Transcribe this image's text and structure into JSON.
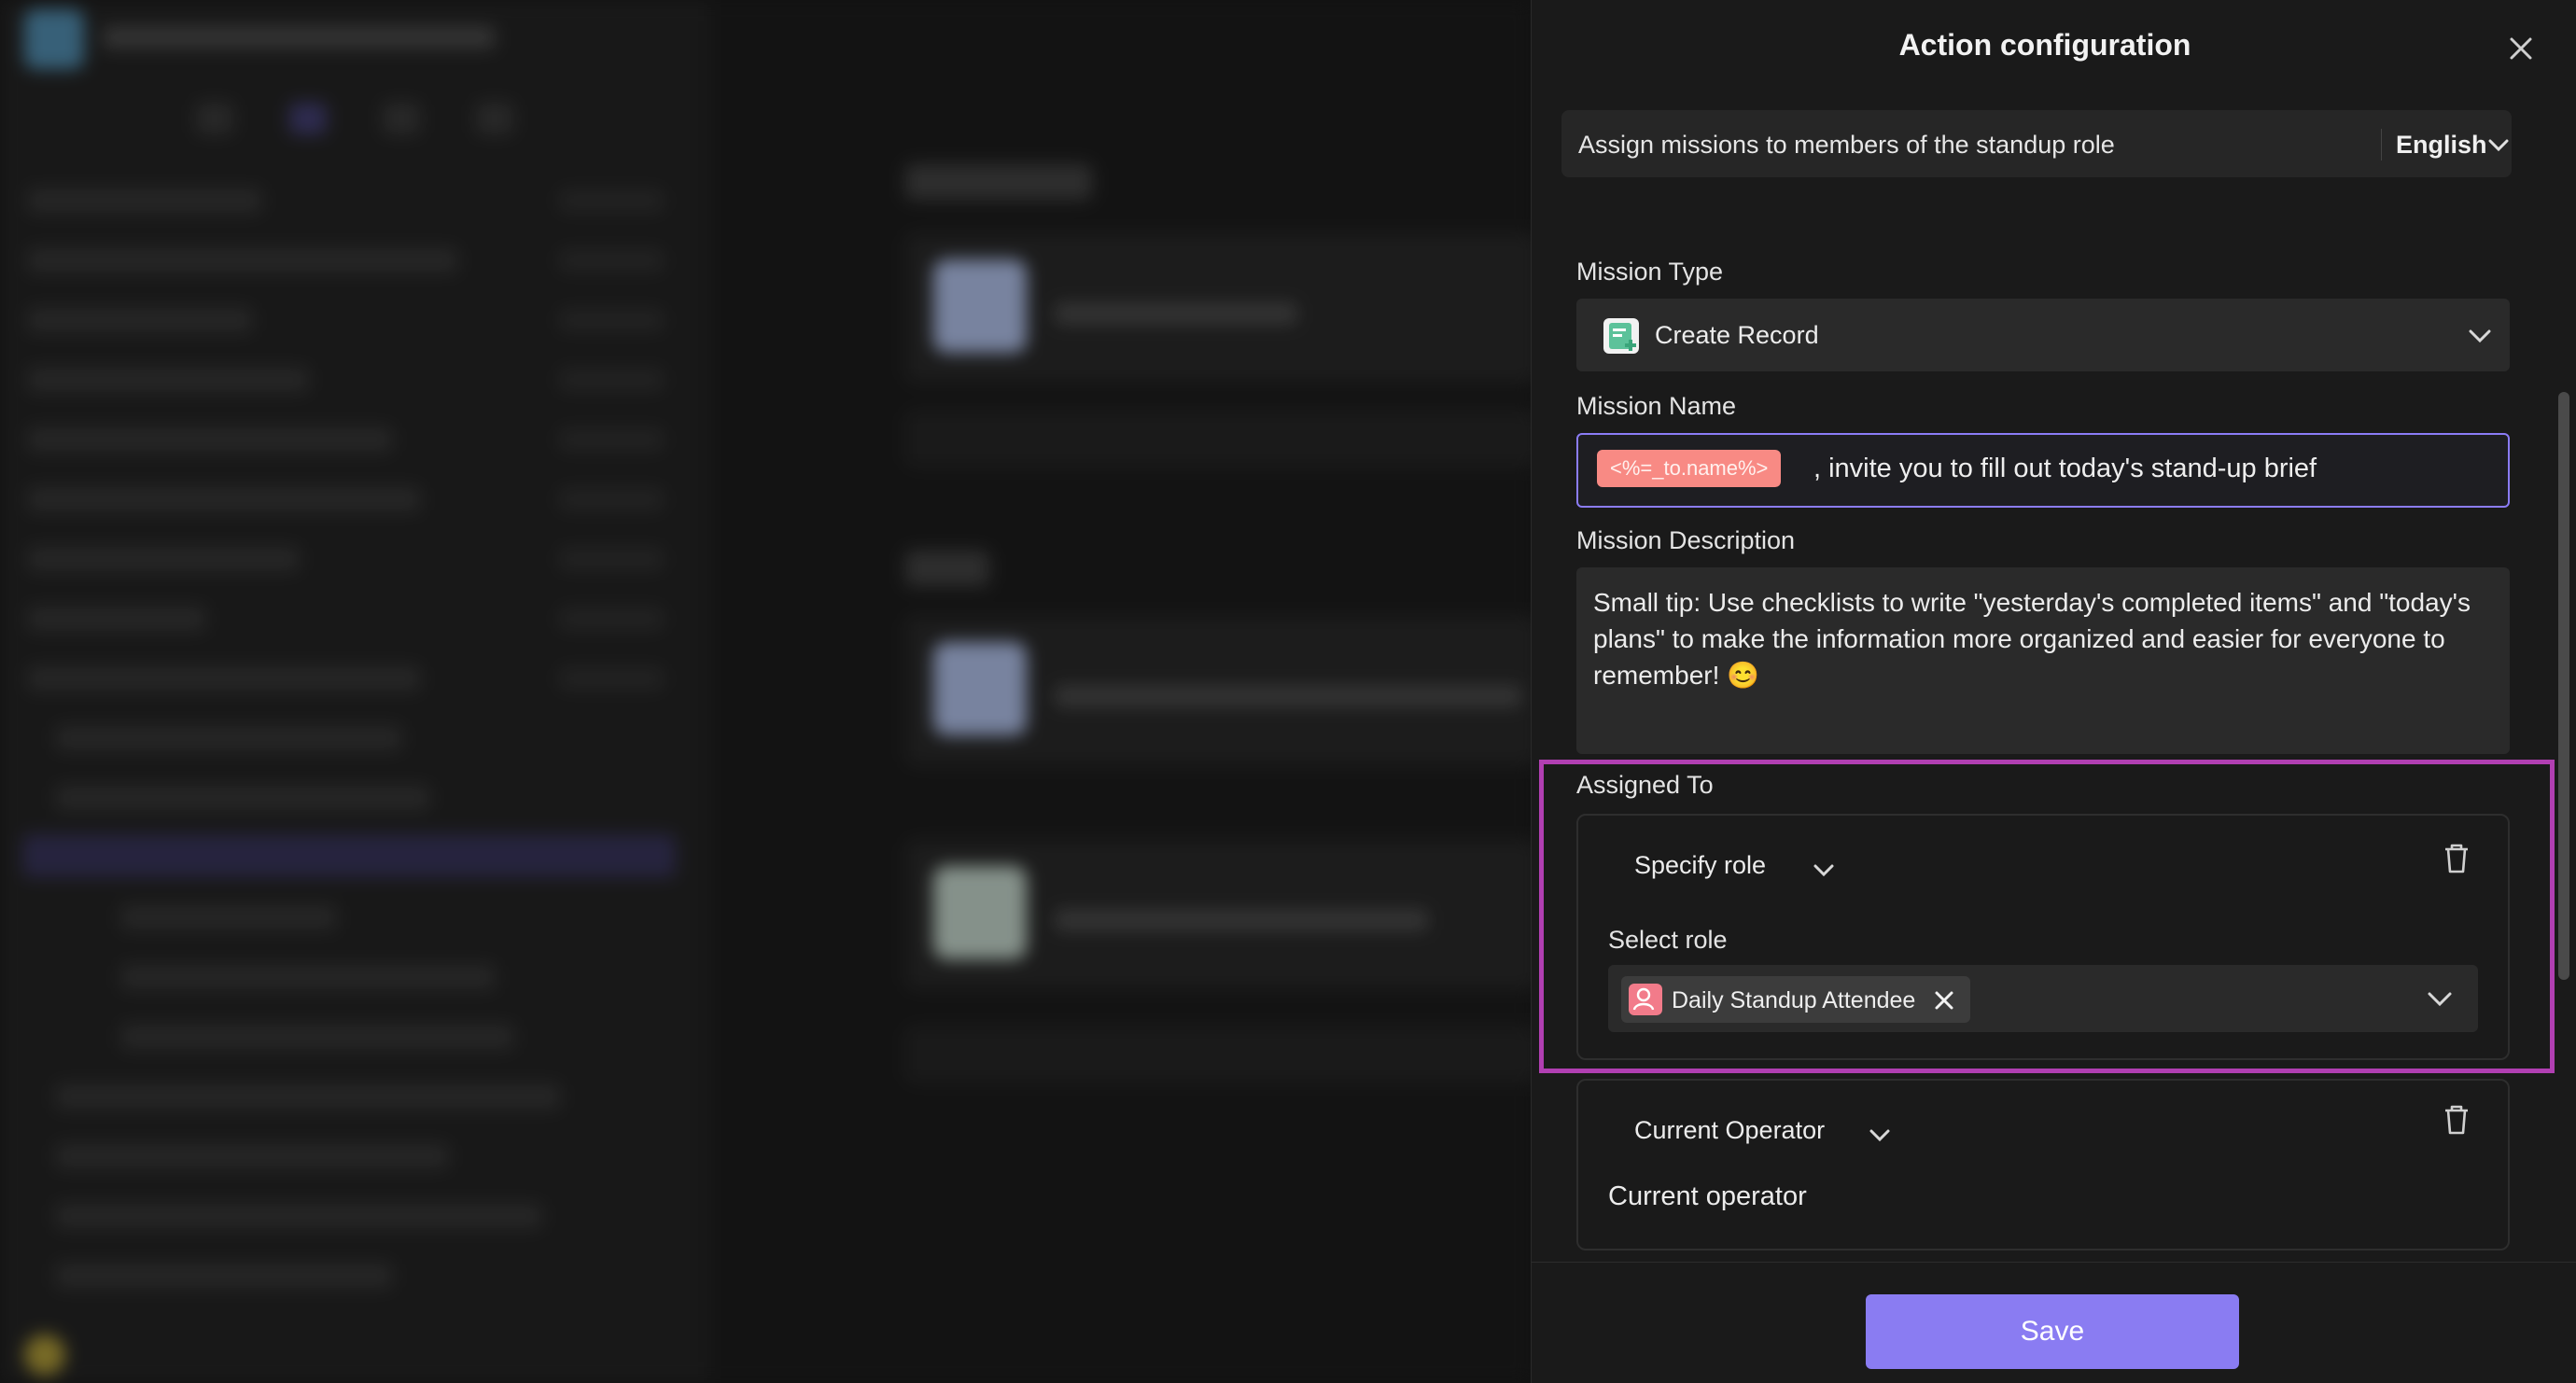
{
  "drawer": {
    "title": "Action configuration"
  },
  "description_bar": {
    "text": "Assign missions to members of the standup role",
    "language": "English"
  },
  "mission_type": {
    "label": "Mission Type",
    "value": "Create Record"
  },
  "mission_name": {
    "label": "Mission Name",
    "variable_tag": "<%=_to.name%>",
    "text": ", invite you to fill out today's stand-up brief"
  },
  "mission_description": {
    "label": "Mission Description",
    "text": "Small tip: Use checklists to write \"yesterday's completed items\" and \"today's plans\" to make the information more organized and easier for everyone to remember! 😊"
  },
  "assigned_to": {
    "label": "Assigned To",
    "entries": [
      {
        "type": "Specify role",
        "sub_label": "Select role",
        "selected_role": "Daily Standup Attendee"
      },
      {
        "type": "Current Operator",
        "value": "Current operator"
      }
    ]
  },
  "footer": {
    "save_label": "Save"
  },
  "colors": {
    "accent": "#8a7cf2",
    "highlight_outline": "#b13fb2",
    "variable_tag": "#f88a84",
    "role_icon": "#f27b8a"
  },
  "icons": [
    "close-icon",
    "chevron-down-icon",
    "create-record-icon",
    "trash-icon",
    "role-icon",
    "remove-icon"
  ]
}
